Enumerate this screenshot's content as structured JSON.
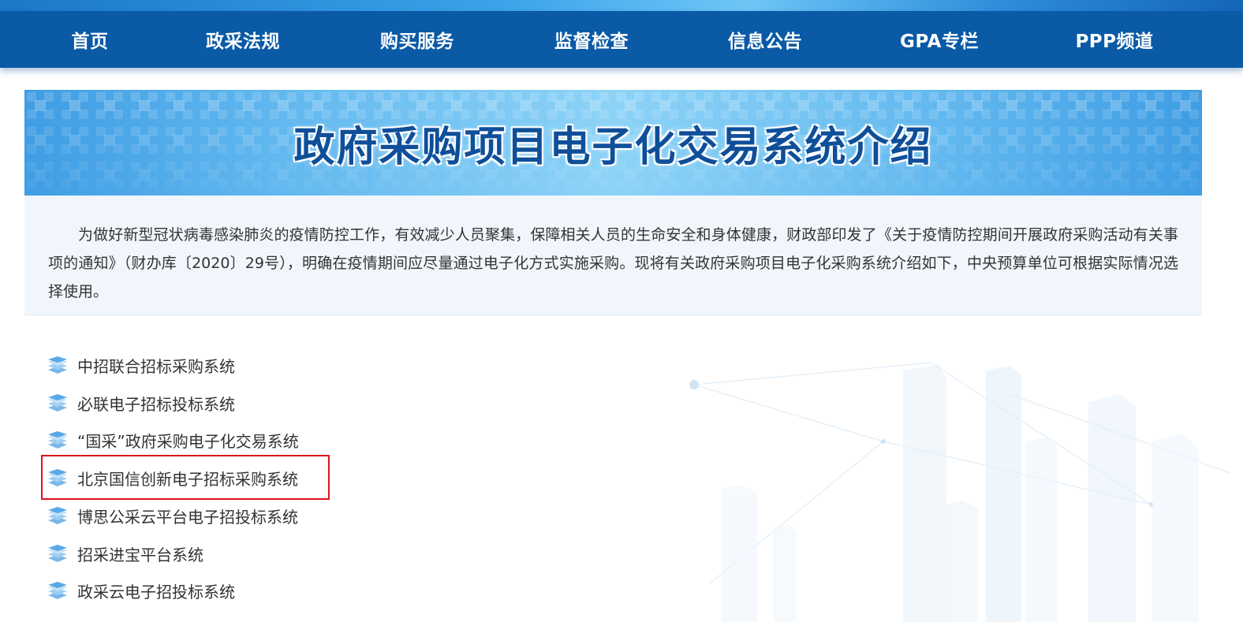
{
  "nav": {
    "items": [
      {
        "label": "首页"
      },
      {
        "label": "政采法规"
      },
      {
        "label": "购买服务"
      },
      {
        "label": "监督检查"
      },
      {
        "label": "信息公告"
      },
      {
        "label": "GPA专栏"
      },
      {
        "label": "PPP频道"
      }
    ]
  },
  "banner": {
    "title": "政府采购项目电子化交易系统介绍"
  },
  "intro": {
    "text": "为做好新型冠状病毒感染肺炎的疫情防控工作，有效减少人员聚集，保障相关人员的生命安全和身体健康，财政部印发了《关于疫情防控期间开展政府采购活动有关事项的通知》（财办库〔2020〕29号），明确在疫情期间应尽量通过电子化方式实施采购。现将有关政府采购项目电子化采购系统介绍如下，中央预算单位可根据实际情况选择使用。"
  },
  "systems": {
    "icon": "layers-stack-icon",
    "items": [
      {
        "label": "中招联合招标采购系统"
      },
      {
        "label": "必联电子招标投标系统"
      },
      {
        "label": "“国采”政府采购电子化交易系统"
      },
      {
        "label": "北京国信创新电子招标采购系统"
      },
      {
        "label": "博思公采云平台电子招投标系统"
      },
      {
        "label": "招采进宝平台系统"
      },
      {
        "label": "政采云电子招投标系统"
      }
    ]
  },
  "colors": {
    "nav_bg": "#0a5aa6",
    "banner_title": "#0f4f9a",
    "highlight": "#e0121a",
    "icon": "#5aa8e6"
  }
}
